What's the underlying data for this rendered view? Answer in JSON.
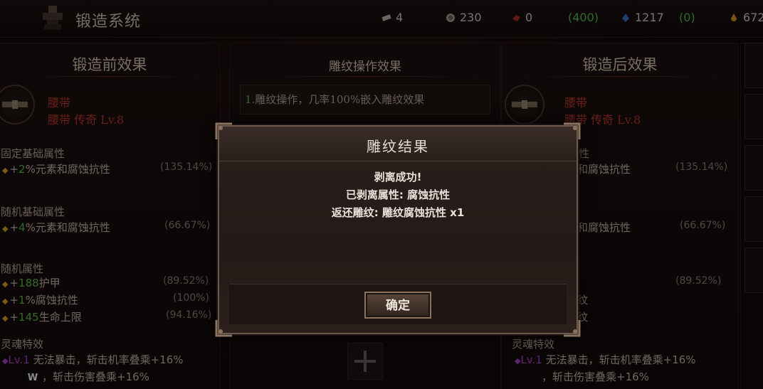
{
  "header": {
    "title": "锻造系统",
    "resources": [
      {
        "icon": "scroll-icon",
        "value": "4"
      },
      {
        "icon": "silver-coin-icon",
        "value": "230"
      },
      {
        "icon": "red-gem-icon",
        "value": "0"
      },
      {
        "icon": "paren-green-1",
        "value": "(400)"
      },
      {
        "icon": "blue-crystal-icon",
        "value": "1217"
      },
      {
        "icon": "paren-green-2",
        "value": "(0)"
      },
      {
        "icon": "gold-drop-icon",
        "value": "672"
      }
    ]
  },
  "left": {
    "title": "锻造前效果",
    "item_name": "腰带",
    "item_sub": "腰带 传奇 Lv.8",
    "fixed_title": "固定基础属性",
    "fixed_row": {
      "plus": "+",
      "value": "2",
      "text": "%元素和腐蚀抗性",
      "pct": "(135.14%)"
    },
    "random_base_title": "随机基础属性",
    "random_base_row": {
      "plus": "+",
      "value": "4",
      "text": "%元素和腐蚀抗性",
      "pct": "(66.67%)"
    },
    "random_title": "随机属性",
    "random_rows": [
      {
        "plus": "+",
        "value": "188",
        "text": "护甲",
        "pct": "(89.52%)"
      },
      {
        "plus": "+",
        "value": "1",
        "text": "%腐蚀抗性",
        "pct": "(100%)"
      },
      {
        "plus": "+",
        "value": "145",
        "text": "生命上限",
        "pct": "(94.16%)"
      }
    ],
    "soul_title": "灵魂特效",
    "soul_lv": "Lv.1",
    "soul_text1": "无法暴击，斩击机率叠乘+16%",
    "soul_text2": "，斩击伤害叠乘+16%"
  },
  "middle": {
    "title": "雕纹操作效果",
    "line_num": "1.",
    "line_text": "雕纹操作，几率100%嵌入雕纹效果"
  },
  "right": {
    "title": "锻造后效果",
    "item_name": "腰带",
    "item_sub": "腰带 传奇 Lv.8",
    "fixed_row": {
      "text": "和腐蚀抗性",
      "pct": "(135.14%)"
    },
    "random_base_row": {
      "text": "和腐蚀抗性",
      "pct": "(66.67%)"
    },
    "random_pct": "(89.52%)",
    "partial1": "纹",
    "partial2": "纹",
    "base_title_partial": "性",
    "soul_title": "灵魂特效",
    "soul_lv": "Lv.1",
    "soul_text1": "无法暴击，斩击机率叠乘+16%",
    "soul_text2": "，斩击伤害叠乘+16%"
  },
  "modal": {
    "title": "雕纹结果",
    "line1": "剥离成功!",
    "line2": "已剥离属性: 腐蚀抗性",
    "line3": "返还雕纹: 雕纹腐蚀抗性 x1",
    "ok_label": "确定"
  },
  "watermark": "W",
  "colors": {
    "green": "#5fc24a",
    "red": "#c0392b",
    "purple": "#b13ed0",
    "gold": "#d4a826"
  }
}
